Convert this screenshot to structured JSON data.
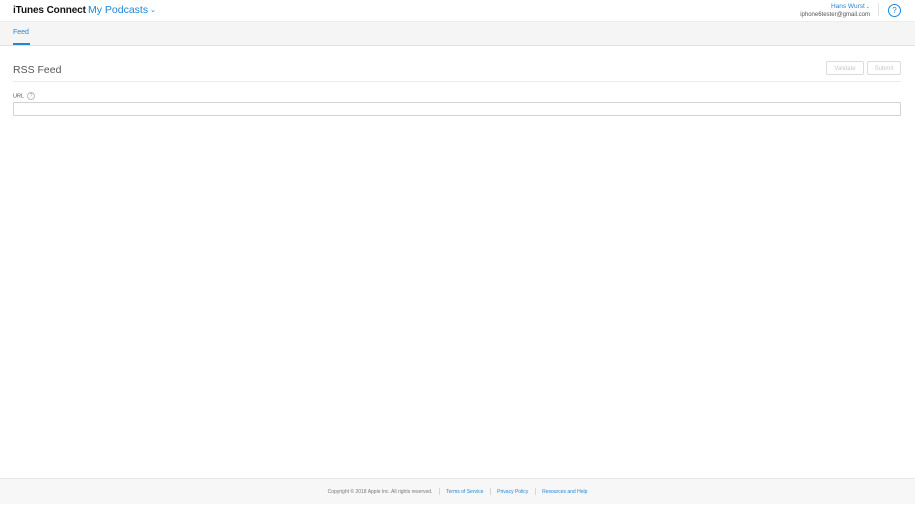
{
  "header": {
    "brand": "iTunes Connect",
    "app_switcher": "My Podcasts",
    "user_name": "Hans Wurst",
    "user_email": "iphone6tester@gmail.com",
    "help_glyph": "?"
  },
  "tabs": [
    {
      "label": "Feed",
      "active": true
    }
  ],
  "main": {
    "title": "RSS Feed",
    "validate_label": "Validate",
    "submit_label": "Submit",
    "url_label": "URL",
    "url_help_glyph": "?",
    "url_value": "",
    "url_placeholder": ""
  },
  "footer": {
    "copyright": "Copyright © 2018 Apple Inc. All rights reserved.",
    "terms": "Terms of Service",
    "privacy": "Privacy Policy",
    "resources": "Resources and Help"
  },
  "colors": {
    "accent": "#1f86d8",
    "tabbar_bg": "#f5f5f5"
  },
  "icons": {
    "app_switcher": "chevron-down-icon",
    "user_menu": "chevron-down-icon",
    "help": "question-circle-icon",
    "url_help": "question-circle-icon"
  }
}
